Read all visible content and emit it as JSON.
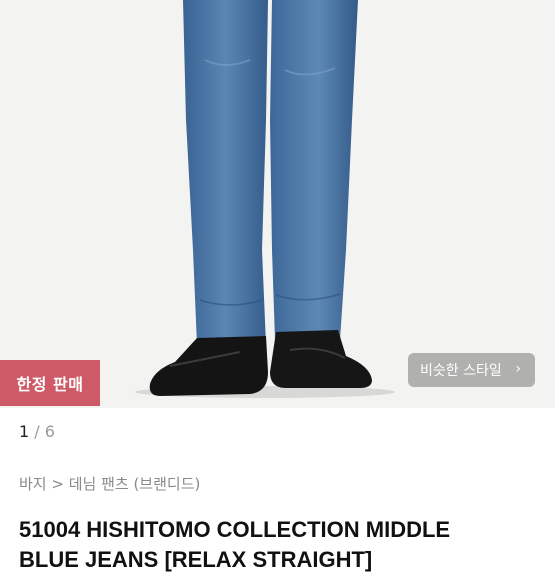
{
  "product_image": {
    "badge_limited": "한정 판매",
    "similar_style_label": "비슷한 스타일",
    "similar_style_chevron": "›"
  },
  "pager": {
    "current": "1",
    "separator": "/",
    "total": "6"
  },
  "breadcrumb": "바지 > 데님 팬츠 (브랜디드)",
  "product": {
    "title_line1": "51004 HISHITOMO COLLECTION MIDDLE",
    "title_line2": "BLUE JEANS [RELAX STRAIGHT]"
  },
  "colors": {
    "badge": "#cf5a67",
    "denim": "#46709f"
  }
}
